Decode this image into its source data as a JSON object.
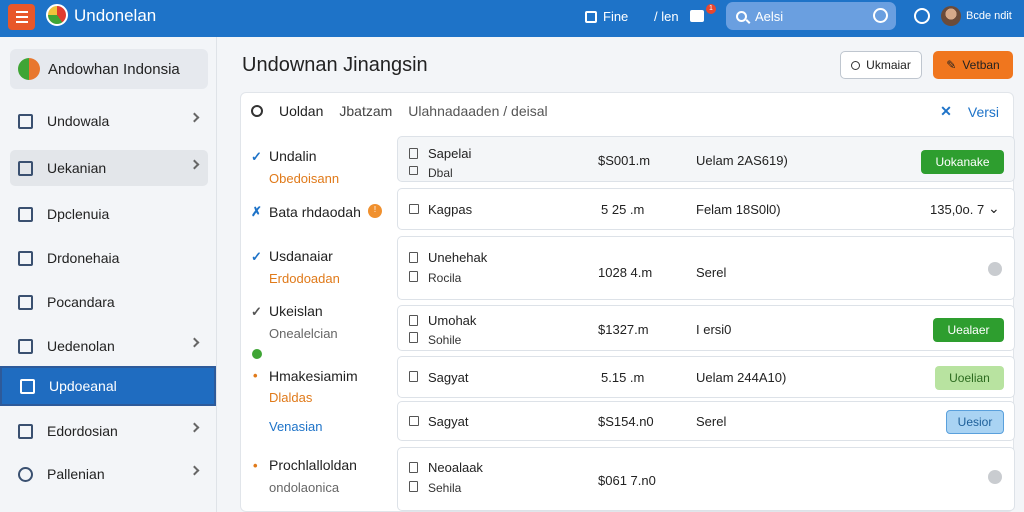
{
  "topbar": {
    "app_title": "Undonelan",
    "item1": "Fine",
    "item2": "/ len",
    "mail_badge": "1",
    "search_placeholder": "Aelsi",
    "user_name": "Bcde ndit"
  },
  "sidebar": {
    "org_name": "Andowhan Indonsia",
    "items": [
      {
        "label": "Undowala",
        "icon": "home-icon"
      },
      {
        "label": "Uekanian",
        "icon": "doc-icon"
      },
      {
        "label": "Dpclenuia",
        "icon": "doc-icon"
      },
      {
        "label": "Drdonehaia",
        "icon": "doc-icon"
      },
      {
        "label": "Pocandara",
        "icon": "edit-icon"
      },
      {
        "label": "Uedenolan",
        "icon": "list-icon"
      },
      {
        "label": "Updoeanal",
        "icon": "list-icon"
      },
      {
        "label": "Edordosian",
        "icon": "doc-icon"
      },
      {
        "label": "Pallenian",
        "icon": "gear-icon"
      }
    ]
  },
  "main": {
    "title": "Undownan Jinangsin",
    "search_button": "Ukmaiar",
    "primary_button": "Vetban",
    "panel": {
      "tab1": "Uoldan",
      "tab2": "Jbatzam",
      "tab3": "Ulahnadaaden / deisal",
      "close_label": "Versi"
    },
    "tree": [
      {
        "label": "Undalin",
        "sub": "Obedoisann",
        "sub_color": "orange",
        "mark": "✓",
        "mark_color": "#1e73c8"
      },
      {
        "label": "Bata rhdaodah",
        "badge": "!",
        "mark": "✗",
        "mark_color": "#1e73c8"
      },
      {
        "label": "Usdanaiar",
        "sub": "Erdodoadan",
        "sub_color": "orange",
        "mark": "✓",
        "mark_color": "#1e73c8"
      },
      {
        "label": "Ukeislan",
        "sub": "Onealelcian",
        "sub_color": "gray",
        "mark": "✓",
        "mark_color": "#555"
      },
      {
        "label": "Hmakesiamim",
        "sub": "Dlaldas",
        "sub_color": "orange",
        "sub2": "Venasian",
        "mark": "•",
        "mark_color": "#e07a1a"
      },
      {
        "label": "Prochlalloldan",
        "sub": "ondolaonica",
        "sub_color": "gray",
        "mark": "•",
        "mark_color": "#e07a1a"
      }
    ],
    "rows": [
      {
        "name": "Sapelai",
        "sub": "Dbal",
        "amount": "$S001.m",
        "status": "Uelam 2AS619)",
        "action": "Uokanake"
      },
      {
        "name": "Kagpas",
        "amount": "5 25 .m",
        "status": "Felam 18S0l0)",
        "extra": "135,0o. 7"
      },
      {
        "name": "Unehehak",
        "sub": "Rocila",
        "amount": "1028 4.m",
        "status": "Serel"
      },
      {
        "name": "Umohak",
        "sub": "Sohile",
        "amount": "$1327.m",
        "status": "I ersi0",
        "action": "Uealaer"
      },
      {
        "name": "Sagyat",
        "amount": "5.15 .m",
        "status": "Uelam 244A10)",
        "action": "Uoelian"
      },
      {
        "name": "Sagyat",
        "amount": "$S154.n0",
        "status": "Serel",
        "action": "Uesior"
      },
      {
        "name": "Neoalaak",
        "sub": "Sehila",
        "amount": "$061 7.n0"
      }
    ]
  },
  "colors": {
    "topbar": "#1e73c8",
    "accent_orange": "#f0761e",
    "active_nav": "#1f6cc0",
    "green": "#2e9e2f"
  }
}
